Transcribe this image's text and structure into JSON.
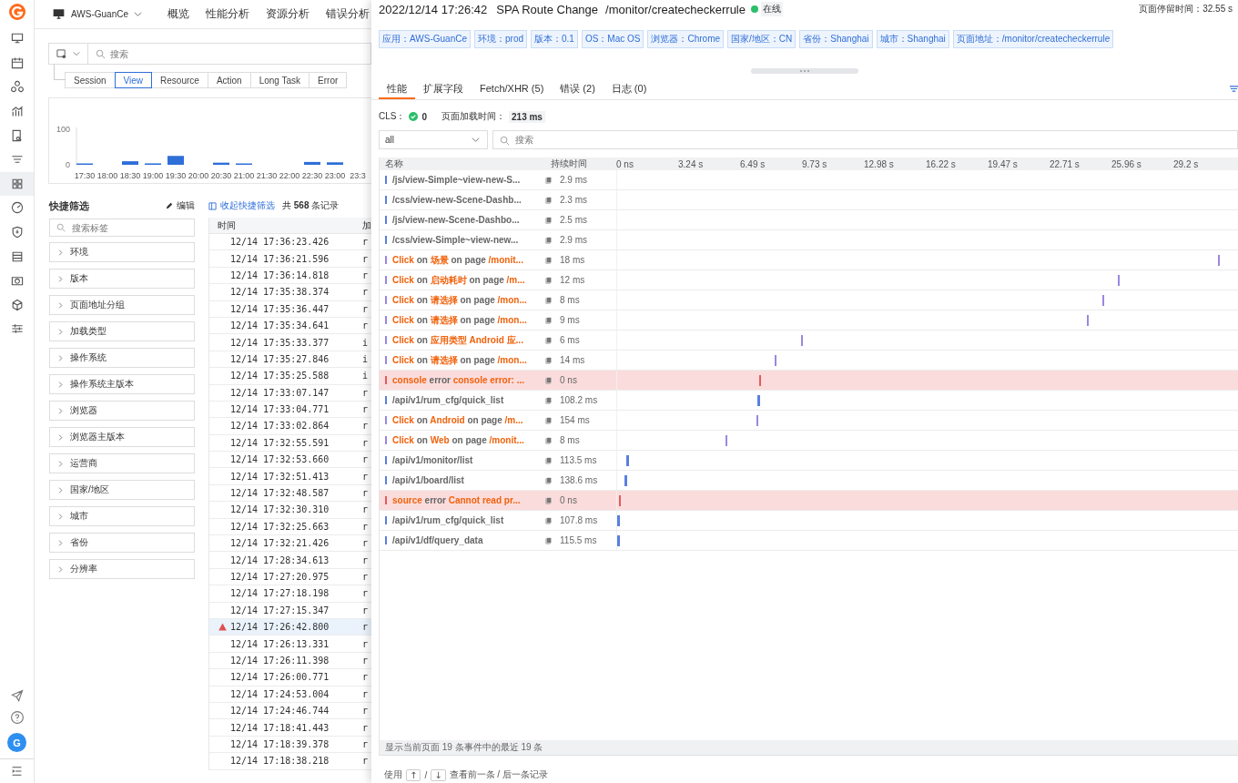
{
  "sidebar": {
    "items": [
      {
        "selected": false
      },
      {
        "selected": false
      },
      {
        "selected": false
      },
      {
        "selected": false
      },
      {
        "selected": false
      },
      {
        "selected": false
      },
      {
        "selected": true
      },
      {
        "selected": false
      },
      {
        "selected": false
      },
      {
        "selected": false
      },
      {
        "selected": false
      },
      {
        "selected": false
      },
      {
        "selected": false
      }
    ],
    "avatar": "G"
  },
  "header": {
    "workspace": "AWS-GuanCe",
    "nav": [
      "概览",
      "性能分析",
      "资源分析",
      "错误分析"
    ]
  },
  "search": {
    "placeholder": "搜索"
  },
  "type_tabs": [
    {
      "label": "Session",
      "selected": false
    },
    {
      "label": "View",
      "selected": true
    },
    {
      "label": "Resource",
      "selected": false
    },
    {
      "label": "Action",
      "selected": false
    },
    {
      "label": "Long Task",
      "selected": false
    },
    {
      "label": "Error",
      "selected": false
    }
  ],
  "histogram": {
    "chart_data": {
      "type": "bar",
      "categories": [
        "17:30",
        "18:00",
        "18:30",
        "19:00",
        "19:30",
        "20:00",
        "20:30",
        "21:00",
        "21:30",
        "22:00",
        "22:30",
        "23:00",
        "23:3"
      ],
      "values": [
        2,
        0,
        10,
        4,
        25,
        0,
        6,
        1,
        0,
        0,
        8,
        7,
        null
      ],
      "yticks": [
        0,
        100
      ],
      "ylim": [
        0,
        100
      ]
    }
  },
  "quick_filter": {
    "title": "快捷筛选",
    "edit": "编辑",
    "placeholder": "搜索标签",
    "groups": [
      "环境",
      "版本",
      "页面地址分组",
      "加载类型",
      "操作系统",
      "操作系统主版本",
      "浏览器",
      "浏览器主版本",
      "运营商",
      "国家/地区",
      "城市",
      "省份",
      "分辨率"
    ]
  },
  "records": {
    "collapse": "收起快捷筛选",
    "count": "共 **568** 条记录",
    "columns": [
      "时间",
      "加"
    ],
    "rows": [
      {
        "time": "12/14 17:36:23.426",
        "column_2": "r",
        "selected": false,
        "warning": false
      },
      {
        "time": "12/14 17:36:21.596",
        "column_2": "r",
        "selected": false,
        "warning": false
      },
      {
        "time": "12/14 17:36:14.818",
        "column_2": "r",
        "selected": false,
        "warning": false
      },
      {
        "time": "12/14 17:35:38.374",
        "column_2": "r",
        "selected": false,
        "warning": false
      },
      {
        "time": "12/14 17:35:36.447",
        "column_2": "r",
        "selected": false,
        "warning": false
      },
      {
        "time": "12/14 17:35:34.641",
        "column_2": "r",
        "selected": false,
        "warning": false
      },
      {
        "time": "12/14 17:35:33.377",
        "column_2": "i",
        "selected": false,
        "warning": false
      },
      {
        "time": "12/14 17:35:27.846",
        "column_2": "i",
        "selected": false,
        "warning": false
      },
      {
        "time": "12/14 17:35:25.588",
        "column_2": "i",
        "selected": false,
        "warning": false
      },
      {
        "time": "12/14 17:33:07.147",
        "column_2": "r",
        "selected": false,
        "warning": false
      },
      {
        "time": "12/14 17:33:04.771",
        "column_2": "r",
        "selected": false,
        "warning": false
      },
      {
        "time": "12/14 17:33:02.864",
        "column_2": "r",
        "selected": false,
        "warning": false
      },
      {
        "time": "12/14 17:32:55.591",
        "column_2": "r",
        "selected": false,
        "warning": false
      },
      {
        "time": "12/14 17:32:53.660",
        "column_2": "r",
        "selected": false,
        "warning": false
      },
      {
        "time": "12/14 17:32:51.413",
        "column_2": "r",
        "selected": false,
        "warning": false
      },
      {
        "time": "12/14 17:32:48.587",
        "column_2": "r",
        "selected": false,
        "warning": false
      },
      {
        "time": "12/14 17:32:30.310",
        "column_2": "r",
        "selected": false,
        "warning": false
      },
      {
        "time": "12/14 17:32:25.663",
        "column_2": "r",
        "selected": false,
        "warning": false
      },
      {
        "time": "12/14 17:32:21.426",
        "column_2": "r",
        "selected": false,
        "warning": false
      },
      {
        "time": "12/14 17:28:34.613",
        "column_2": "r",
        "selected": false,
        "warning": false
      },
      {
        "time": "12/14 17:27:20.975",
        "column_2": "r",
        "selected": false,
        "warning": false
      },
      {
        "time": "12/14 17:27:18.198",
        "column_2": "r",
        "selected": false,
        "warning": false
      },
      {
        "time": "12/14 17:27:15.347",
        "column_2": "r",
        "selected": false,
        "warning": false
      },
      {
        "time": "12/14 17:26:42.800",
        "column_2": "r",
        "selected": true,
        "warning": true
      },
      {
        "time": "12/14 17:26:13.331",
        "column_2": "r",
        "selected": false,
        "warning": false
      },
      {
        "time": "12/14 17:26:11.398",
        "column_2": "r",
        "selected": false,
        "warning": false
      },
      {
        "time": "12/14 17:26:00.771",
        "column_2": "r",
        "selected": false,
        "warning": false
      },
      {
        "time": "12/14 17:24:53.004",
        "column_2": "r",
        "selected": false,
        "warning": false
      },
      {
        "time": "12/14 17:24:46.744",
        "column_2": "r",
        "selected": false,
        "warning": false
      },
      {
        "time": "12/14 17:18:41.443",
        "column_2": "r",
        "selected": false,
        "warning": false
      },
      {
        "time": "12/14 17:18:39.378",
        "column_2": "r",
        "selected": false,
        "warning": false
      },
      {
        "time": "12/14 17:18:38.218",
        "column_2": "r",
        "selected": false,
        "warning": false
      }
    ]
  },
  "drawer": {
    "time": "2022/12/14 17:26:42",
    "type": "SPA Route Change",
    "path": "/monitor/createcheckerrule",
    "status": "在线",
    "online": true,
    "stay": "页面停留时间：32.55 s",
    "tags": [
      "应用：AWS-GuanCe",
      "环境：prod",
      "版本：0.1",
      "OS：Mac OS",
      "浏览器：Chrome",
      "国家/地区：CN",
      "省份：Shanghai",
      "城市：Shanghai",
      "页面地址：/monitor/createcheckerrule"
    ],
    "tabs": [
      {
        "label": "性能",
        "selected": true
      },
      {
        "label": "扩展字段",
        "selected": false
      },
      {
        "label": "Fetch/XHR (5)",
        "selected": false
      },
      {
        "label": "错误 (2)",
        "selected": false
      },
      {
        "label": "日志 (0)",
        "selected": false
      }
    ],
    "cls_label": "CLS：",
    "cls_value": "0",
    "load_label": "页面加载时间：",
    "load_value": "213 ms",
    "type_select": "all",
    "search_placeholder": "搜索",
    "columns": [
      "名称",
      "持续时间"
    ],
    "ticks": [
      "0 ns",
      "3.24 s",
      "6.49 s",
      "9.73 s",
      "12.98 s",
      "16.22 s",
      "19.47 s",
      "22.71 s",
      "25.96 s",
      "29.2 s"
    ],
    "events": [
      {
        "kind": "resource",
        "name": "/js/view-Simple~view-new-S...",
        "duration": "2.9 ms"
      },
      {
        "kind": "resource",
        "name": "/css/view-new-Scene-Dashb...",
        "duration": "2.3 ms"
      },
      {
        "kind": "resource",
        "name": "/js/view-new-Scene-Dashbo...",
        "duration": "2.5 ms"
      },
      {
        "kind": "resource",
        "name": "/css/view-Simple~view-new...",
        "duration": "2.9 ms"
      },
      {
        "kind": "action",
        "name": "**Click** on **场景** on page **/monit...**",
        "duration": "18 ms",
        "level": 0.968
      },
      {
        "kind": "action",
        "name": "**Click** on **启动耗时** on page **/m...**",
        "duration": "12 ms",
        "level": 0.806
      },
      {
        "kind": "action",
        "name": "**Click** on **请选择** on page **/mon...**",
        "duration": "8 ms",
        "level": 0.781
      },
      {
        "kind": "action",
        "name": "**Click** on **请选择** on page **/mon...**",
        "duration": "9 ms",
        "level": 0.756
      },
      {
        "kind": "action",
        "name": "**Click** on **应用类型 Android 应...**",
        "duration": "6 ms",
        "level": 0.296
      },
      {
        "kind": "action",
        "name": "**Click** on **请选择** on page **/mon...**",
        "duration": "14 ms",
        "level": 0.253
      },
      {
        "kind": "error",
        "name": "**console** error **console error: ...**",
        "duration": "0 ns",
        "level": 0.229
      },
      {
        "kind": "resource",
        "name": "/api/v1/rum_cfg/quick_list",
        "duration": "108.2 ms",
        "level": 0.226
      },
      {
        "kind": "action",
        "name": "**Click** on **Android** on page **/m...**",
        "duration": "154 ms",
        "level": 0.224
      },
      {
        "kind": "action",
        "name": "**Click** on **Web** on page **/monit...**",
        "duration": "8 ms",
        "level": 0.174
      },
      {
        "kind": "resource",
        "name": "/api/v1/monitor/list",
        "duration": "113.5 ms",
        "level": 0.015
      },
      {
        "kind": "resource",
        "name": "/api/v1/board/list",
        "duration": "138.6 ms",
        "level": 0.012
      },
      {
        "kind": "error",
        "name": "**source** error **Cannot read pr...**",
        "duration": "0 ns",
        "level": 0.003
      },
      {
        "kind": "resource",
        "name": "/api/v1/rum_cfg/quick_list",
        "duration": "107.8 ms",
        "level": 0.0
      },
      {
        "kind": "resource",
        "name": "/api/v1/df/query_data",
        "duration": "115.5 ms",
        "level": 0.0
      }
    ],
    "footer": "显示当前页面 19 条事件中的最近 19 条",
    "hint": {
      "before": "使用",
      "up": "↑",
      "sep": "/",
      "down": "↓",
      "after": "查看前一条 / 后一条记录"
    }
  }
}
